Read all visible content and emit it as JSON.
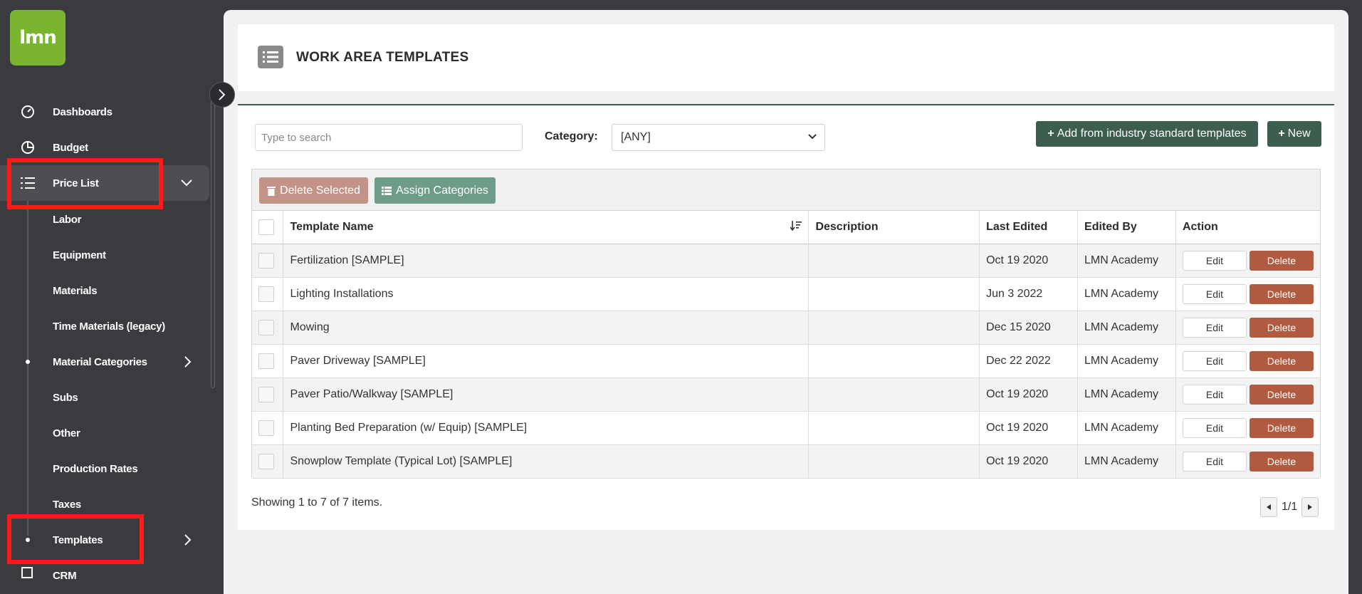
{
  "app": {
    "logo_text": "lmn"
  },
  "sidebar": {
    "items": [
      {
        "label": "Dashboards",
        "icon": "gauge-icon"
      },
      {
        "label": "Budget",
        "icon": "pie-chart-icon"
      },
      {
        "label": "Price List",
        "icon": "list-icon",
        "expanded": true
      }
    ],
    "subitems": [
      {
        "label": "Labor"
      },
      {
        "label": "Equipment"
      },
      {
        "label": "Materials"
      },
      {
        "label": "Time Materials (legacy)"
      },
      {
        "label": "Material Categories"
      },
      {
        "label": "Subs"
      },
      {
        "label": "Other"
      },
      {
        "label": "Production Rates"
      },
      {
        "label": "Taxes"
      },
      {
        "label": "Templates"
      }
    ],
    "partial_item": {
      "label": "CRM"
    }
  },
  "page": {
    "title": "WORK AREA TEMPLATES"
  },
  "filters": {
    "search_placeholder": "Type to search",
    "category_label": "Category:",
    "category_value": "[ANY]"
  },
  "buttons": {
    "add_standard": "Add from industry standard templates",
    "new": "New",
    "delete_selected": "Delete Selected",
    "assign_categories": "Assign Categories",
    "edit": "Edit",
    "delete": "Delete"
  },
  "table": {
    "columns": [
      "Template Name",
      "Description",
      "Last Edited",
      "Edited By",
      "Action"
    ],
    "rows": [
      {
        "name": "Fertilization [SAMPLE]",
        "description": "",
        "last_edited": "Oct 19 2020",
        "edited_by": "LMN Academy"
      },
      {
        "name": "Lighting Installations",
        "description": "",
        "last_edited": "Jun 3 2022",
        "edited_by": "LMN Academy"
      },
      {
        "name": "Mowing",
        "description": "",
        "last_edited": "Dec 15 2020",
        "edited_by": "LMN Academy"
      },
      {
        "name": "Paver Driveway [SAMPLE]",
        "description": "",
        "last_edited": "Dec 22 2022",
        "edited_by": "LMN Academy"
      },
      {
        "name": "Paver Patio/Walkway [SAMPLE]",
        "description": "",
        "last_edited": "Oct 19 2020",
        "edited_by": "LMN Academy"
      },
      {
        "name": "Planting Bed Preparation (w/ Equip) [SAMPLE]",
        "description": "",
        "last_edited": "Oct 19 2020",
        "edited_by": "LMN Academy"
      },
      {
        "name": "Snowplow Template (Typical Lot) [SAMPLE]",
        "description": "",
        "last_edited": "Oct 19 2020",
        "edited_by": "LMN Academy"
      }
    ]
  },
  "footer": {
    "showing": "Showing 1 to 7 of 7 items.",
    "page_indicator": "1/1"
  },
  "colors": {
    "accent": "#3d5e4f",
    "logo": "#7ab530",
    "delete": "#b05b40",
    "highlight": "#ff1a1a"
  }
}
